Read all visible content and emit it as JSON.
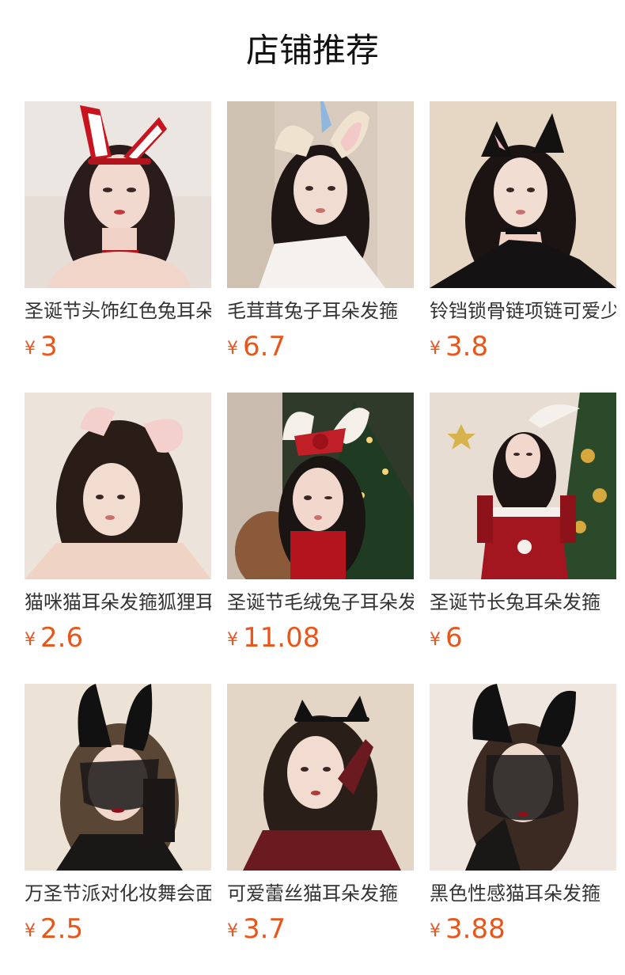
{
  "section": {
    "title": "店铺推荐"
  },
  "currency_symbol": "¥",
  "colors": {
    "price": "#e8561b"
  },
  "products": [
    {
      "name": "圣诞节头饰红色兔耳朵",
      "price": "3",
      "image": "red-bunny-ears-headband-photo"
    },
    {
      "name": "毛茸茸兔子耳朵发箍",
      "price": "6.7",
      "image": "fluffy-bunny-ears-headband-photo"
    },
    {
      "name": "铃铛锁骨链项链可爱少女",
      "price": "3.8",
      "image": "black-cat-ears-choker-photo"
    },
    {
      "name": "猫咪猫耳朵发箍狐狸耳",
      "price": "2.6",
      "image": "pink-cat-ears-headband-photo"
    },
    {
      "name": "圣诞节毛绒兔子耳朵发箍",
      "price": "11.08",
      "image": "christmas-plush-bunny-ears-photo"
    },
    {
      "name": "圣诞节长兔耳朵发箍",
      "price": "6",
      "image": "christmas-long-bunny-ears-photo"
    },
    {
      "name": "万圣节派对化妆舞会面纱",
      "price": "2.5",
      "image": "lace-bunny-veil-photo"
    },
    {
      "name": "可爱蕾丝猫耳朵发箍",
      "price": "3.7",
      "image": "lace-cat-ears-headband-photo"
    },
    {
      "name": "黑色性感猫耳朵发箍",
      "price": "3.88",
      "image": "black-lace-cat-ears-veil-photo"
    }
  ]
}
